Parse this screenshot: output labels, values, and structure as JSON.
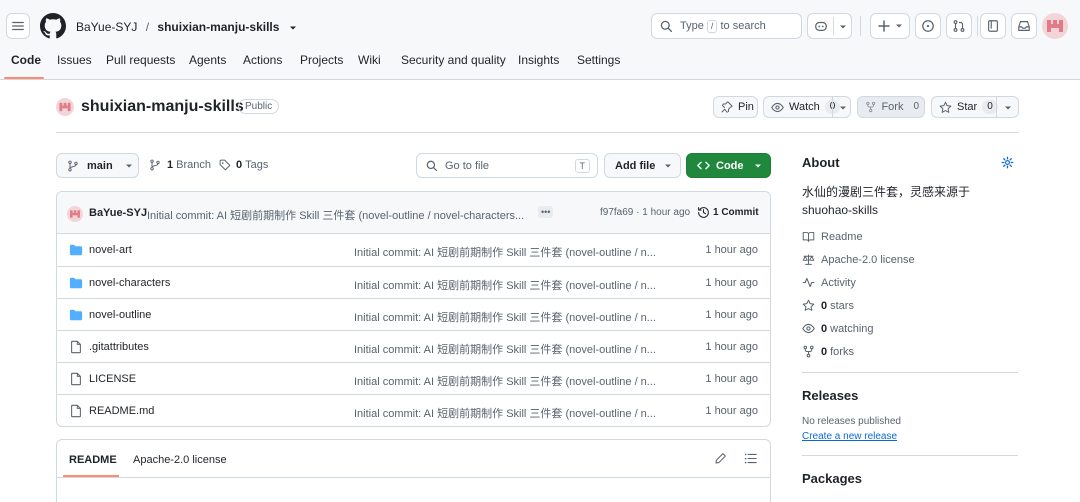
{
  "header": {
    "owner": "BaYue-SYJ",
    "separator": "/",
    "repo": "shuixian-manju-skills",
    "search_prefix": "Type",
    "search_key": "/",
    "search_suffix": "to search"
  },
  "tabs": [
    {
      "label": "Code"
    },
    {
      "label": "Issues"
    },
    {
      "label": "Pull requests"
    },
    {
      "label": "Agents"
    },
    {
      "label": "Actions"
    },
    {
      "label": "Projects"
    },
    {
      "label": "Wiki"
    },
    {
      "label": "Security and quality"
    },
    {
      "label": "Insights"
    },
    {
      "label": "Settings"
    }
  ],
  "repo_head": {
    "name": "shuixian-manju-skills",
    "visibility": "Public",
    "pin_label": "Pin",
    "watch_label": "Watch",
    "watch_count": "0",
    "fork_label": "Fork",
    "fork_count": "0",
    "star_label": "Star",
    "star_count": "0"
  },
  "toolbar": {
    "branch": "main",
    "branch_count": "1",
    "branch_label": "Branch",
    "tag_count": "0",
    "tag_label": "Tags",
    "goto_placeholder": "Go to file",
    "goto_key": "T",
    "add_file_label": "Add file",
    "code_label": "Code"
  },
  "latest_commit": {
    "author": "BaYue-SYJ",
    "message": "Initial commit: AI 短剧前期制作 Skill 三件套 (novel-outline / novel-characters...",
    "ellipsis": "•••",
    "hash": "f97fa69",
    "dot": "·",
    "age": "1 hour ago",
    "commit_count": "1 Commit"
  },
  "files": [
    {
      "type": "folder",
      "name": "novel-art",
      "message": "Initial commit: AI 短剧前期制作 Skill 三件套 (novel-outline / n...",
      "age": "1 hour ago"
    },
    {
      "type": "folder",
      "name": "novel-characters",
      "message": "Initial commit: AI 短剧前期制作 Skill 三件套 (novel-outline / n...",
      "age": "1 hour ago"
    },
    {
      "type": "folder",
      "name": "novel-outline",
      "message": "Initial commit: AI 短剧前期制作 Skill 三件套 (novel-outline / n...",
      "age": "1 hour ago"
    },
    {
      "type": "file",
      "name": ".gitattributes",
      "message": "Initial commit: AI 短剧前期制作 Skill 三件套 (novel-outline / n...",
      "age": "1 hour ago"
    },
    {
      "type": "file",
      "name": "LICENSE",
      "message": "Initial commit: AI 短剧前期制作 Skill 三件套 (novel-outline / n...",
      "age": "1 hour ago"
    },
    {
      "type": "file",
      "name": "README.md",
      "message": "Initial commit: AI 短剧前期制作 Skill 三件套 (novel-outline / n...",
      "age": "1 hour ago"
    }
  ],
  "readme": {
    "tab_readme": "README",
    "tab_license": "Apache-2.0 license"
  },
  "about": {
    "title": "About",
    "description_line1": "水仙的漫剧三件套，灵感来源于",
    "description_line2": "shuohao-skills",
    "readme": "Readme",
    "license": "Apache-2.0 license",
    "activity": "Activity",
    "stars_count": "0",
    "stars_label": "stars",
    "watching_count": "0",
    "watching_label": "watching",
    "forks_count": "0",
    "forks_label": "forks"
  },
  "releases": {
    "title": "Releases",
    "empty": "No releases published",
    "create": "Create a new release"
  },
  "packages": {
    "title": "Packages"
  },
  "colors": {
    "accent": "#0969da",
    "green": "#1f883d",
    "tab_underline": "#fd8c73",
    "folder": "#54aeff"
  }
}
